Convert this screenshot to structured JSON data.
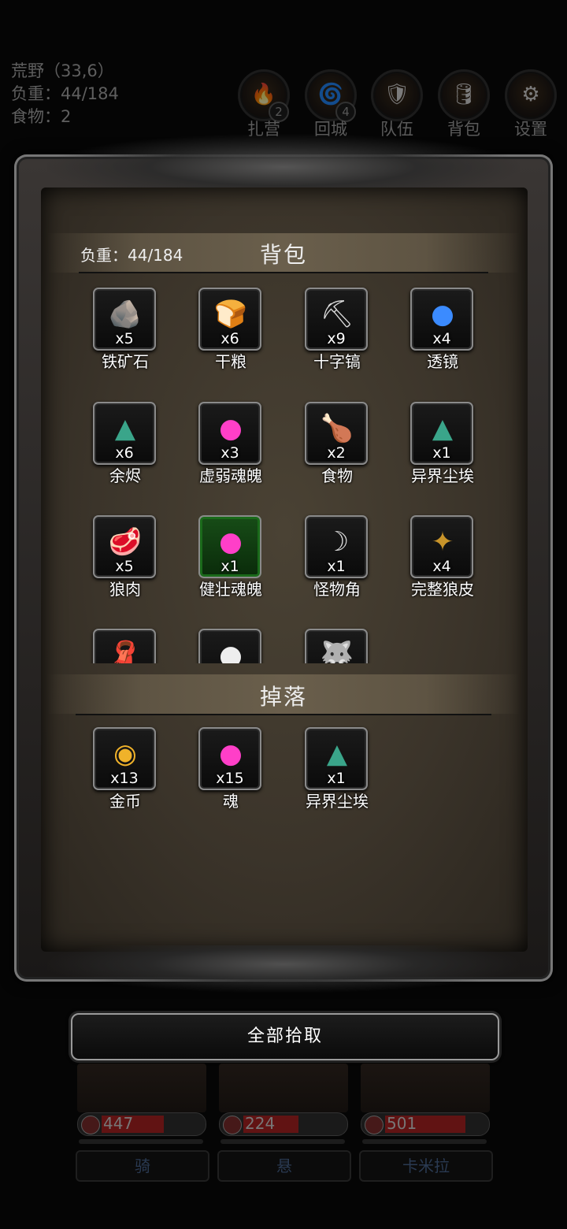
{
  "status": {
    "location": "荒野（33,6）",
    "load": "负重：44/184",
    "food": "食物：2"
  },
  "top_buttons": [
    {
      "label": "扎营",
      "badge": "2",
      "icon": "campfire-icon"
    },
    {
      "label": "回城",
      "badge": "4",
      "icon": "portal-icon"
    },
    {
      "label": "队伍",
      "badge": "",
      "icon": "banner-icon"
    },
    {
      "label": "背包",
      "badge": "",
      "icon": "barrel-icon"
    },
    {
      "label": "设置",
      "badge": "",
      "icon": "gear-icon"
    }
  ],
  "backpack": {
    "title": "背包",
    "load": "负重：44/184",
    "items": [
      {
        "name": "铁矿石",
        "qty": "x5",
        "icon": "iron-ore-icon"
      },
      {
        "name": "干粮",
        "qty": "x6",
        "icon": "bread-icon"
      },
      {
        "name": "十字镐",
        "qty": "x9",
        "icon": "pickaxe-icon"
      },
      {
        "name": "透镜",
        "qty": "x4",
        "icon": "lens-icon"
      },
      {
        "name": "余烬",
        "qty": "x6",
        "icon": "dust-pile-icon"
      },
      {
        "name": "虚弱魂魄",
        "qty": "x3",
        "icon": "soul-flame-icon"
      },
      {
        "name": "食物",
        "qty": "x2",
        "icon": "meat-leg-icon"
      },
      {
        "name": "异界尘埃",
        "qty": "x1",
        "icon": "dust-pile-icon"
      },
      {
        "name": "狼肉",
        "qty": "x5",
        "icon": "raw-meat-icon"
      },
      {
        "name": "健壮魂魄",
        "qty": "x1",
        "icon": "soul-flame-icon"
      },
      {
        "name": "怪物角",
        "qty": "x1",
        "icon": "horn-icon"
      },
      {
        "name": "完整狼皮",
        "qty": "x4",
        "icon": "wolf-pelt-icon"
      }
    ],
    "partial_items": [
      "cloth-icon",
      "skull-icon",
      "wolf-icon"
    ]
  },
  "drops": {
    "title": "掉落",
    "items": [
      {
        "name": "金币",
        "qty": "x13",
        "icon": "gold-coins-icon"
      },
      {
        "name": "魂",
        "qty": "x15",
        "icon": "soul-flame-icon"
      },
      {
        "name": "异界尘埃",
        "qty": "x1",
        "icon": "dust-pile-icon"
      }
    ]
  },
  "pickup_all": "全部拾取",
  "heroes": [
    {
      "hp": "447",
      "hp_fraction": 0.62,
      "name": "骑"
    },
    {
      "hp": "224",
      "hp_fraction": 0.55,
      "name": "悬"
    },
    {
      "hp": "501",
      "hp_fraction": 0.8,
      "name": "卡米拉"
    }
  ]
}
